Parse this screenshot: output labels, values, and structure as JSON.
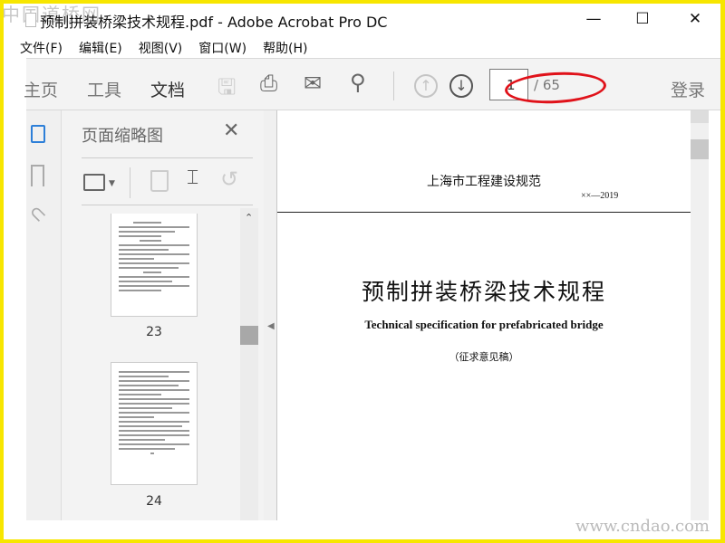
{
  "watermark": {
    "top": "中国道桥网",
    "bottom": "www.cndao.com"
  },
  "window": {
    "title": "预制拼装桥梁技术规程.pdf - Adobe Acrobat Pro DC",
    "minimize": "—",
    "maximize": "☐",
    "close": "✕"
  },
  "menu": [
    "文件(F)",
    "编辑(E)",
    "视图(V)",
    "窗口(W)",
    "帮助(H)"
  ],
  "toolbar": {
    "tabs": [
      "主页",
      "工具",
      "文档"
    ],
    "active_tab": "文档",
    "page_current": "1",
    "page_total": "/ 65",
    "signin": "登录",
    "annotation_color": "#e0121a"
  },
  "panel": {
    "title": "页面缩略图",
    "close": "✕",
    "thumbnails": [
      {
        "label": "23"
      },
      {
        "label": "24"
      }
    ]
  },
  "document": {
    "header": "上海市工程建设规范",
    "code": "××—2019",
    "title": "预制拼装桥梁技术规程",
    "subtitle": "Technical specification for prefabricated bridge",
    "status": "（征求意见稿）"
  }
}
